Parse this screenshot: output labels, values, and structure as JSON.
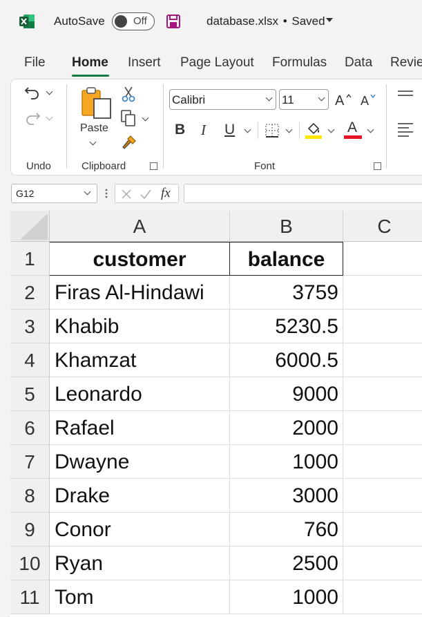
{
  "title_bar": {
    "autosave_label": "AutoSave",
    "autosave_state": "Off",
    "file_name": "database.xlsx",
    "separator": "•",
    "save_status": "Saved"
  },
  "tabs": [
    {
      "label": "File",
      "active": false
    },
    {
      "label": "Home",
      "active": true
    },
    {
      "label": "Insert",
      "active": false
    },
    {
      "label": "Page Layout",
      "active": false
    },
    {
      "label": "Formulas",
      "active": false
    },
    {
      "label": "Data",
      "active": false
    },
    {
      "label": "Revie",
      "active": false
    }
  ],
  "ribbon": {
    "undo_group": "Undo",
    "clipboard_group": "Clipboard",
    "font_group": "Font",
    "paste_label": "Paste",
    "font_name": "Calibri",
    "font_size": "11",
    "bold": "B",
    "italic": "I",
    "underline": "U",
    "font_color_letter": "A",
    "fill_color": "#ffe600",
    "font_color": "#e81123",
    "accent": "#107c41"
  },
  "formula_bar": {
    "name_box": "G12",
    "fx": "fx",
    "formula": ""
  },
  "sheet": {
    "columns": [
      "A",
      "B",
      "C"
    ],
    "rows": [
      {
        "num": "1",
        "a": "customer",
        "b": "balance"
      },
      {
        "num": "2",
        "a": "Firas Al-Hindawi",
        "b": "3759"
      },
      {
        "num": "3",
        "a": "Khabib",
        "b": "5230.5"
      },
      {
        "num": "4",
        "a": "Khamzat",
        "b": "6000.5"
      },
      {
        "num": "5",
        "a": "Leonardo",
        "b": "9000"
      },
      {
        "num": "6",
        "a": "Rafael",
        "b": "2000"
      },
      {
        "num": "7",
        "a": "Dwayne",
        "b": "1000"
      },
      {
        "num": "8",
        "a": "Drake",
        "b": "3000"
      },
      {
        "num": "9",
        "a": "Conor",
        "b": "760"
      },
      {
        "num": "10",
        "a": "Ryan",
        "b": "2500"
      },
      {
        "num": "11",
        "a": "Tom",
        "b": "1000"
      }
    ]
  }
}
